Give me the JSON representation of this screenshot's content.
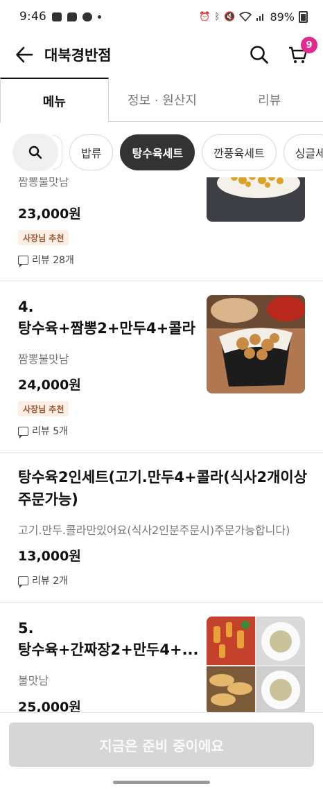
{
  "status_bar": {
    "time": "9:46",
    "battery": "89%",
    "icons_left": [
      "image-icon",
      "chat-bubble-icon",
      "cloud-icon"
    ],
    "icons_right": [
      "alarm-icon",
      "bluetooth-icon",
      "mute-icon",
      "wifi-icon",
      "signal-icon",
      "battery-icon"
    ]
  },
  "header": {
    "title": "대북경반점",
    "cart_count": "9"
  },
  "tabs": [
    {
      "label": "메뉴",
      "active": true
    },
    {
      "label": "정보 · 원산지",
      "active": false
    },
    {
      "label": "리뷰",
      "active": false
    }
  ],
  "categories": [
    {
      "label": "밥류",
      "active": false
    },
    {
      "label": "탕수육세트",
      "active": true
    },
    {
      "label": "깐풍육세트",
      "active": false
    },
    {
      "label": "싱글세",
      "active": false
    }
  ],
  "items": [
    {
      "name": "",
      "desc": "짬뽕불맛남",
      "price": "23,000원",
      "badge": "사장님 추천",
      "review": "리뷰 28개"
    },
    {
      "name_line1": "4.",
      "name_line2": "탕수육+짬뽕2+만두4+콜라",
      "desc": "짬뽕불맛남",
      "price": "24,000원",
      "badge": "사장님 추천",
      "review": "리뷰 5개"
    },
    {
      "name_line1": "탕수육2인세트(고기.만두4+콜라(식사2개이상",
      "name_line2": "주문가능)",
      "desc": "고기.만두.콜라만있어요(식사2인분주문시)주문가능합니다)",
      "price": "13,000원",
      "review": "리뷰 2개"
    },
    {
      "name_line1": "5.",
      "name_line2": "탕수육+간짜장2+만두4+...",
      "desc": "불맛남",
      "price": "25,000원"
    }
  ],
  "bottom": {
    "button_label": "지금은 준비 중이에요"
  },
  "colors": {
    "badge_bg": "#fbeee4",
    "badge_text": "#9a5a33",
    "cart_badge": "#e02b8f",
    "active_chip": "#333333",
    "disabled_button": "#d6d6d6"
  }
}
